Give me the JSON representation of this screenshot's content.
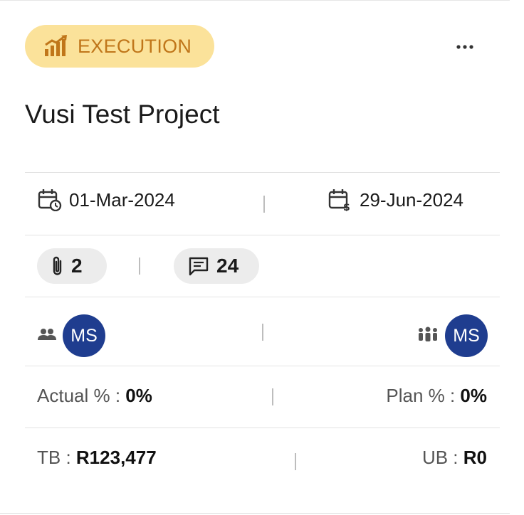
{
  "card": {
    "stage": {
      "label": "EXECUTION",
      "icon": "chart-growth-icon",
      "color": "#c0761a",
      "background": "#fbe29a"
    },
    "menu": {
      "icon": "more-horizontal-icon"
    },
    "title": "Vusi Test Project",
    "dates": {
      "start": {
        "value": "01-Mar-2024",
        "icon": "calendar-clock-icon"
      },
      "end": {
        "value": "29-Jun-2024",
        "icon": "calendar-dollar-icon"
      }
    },
    "counts": {
      "attachments": {
        "value": "2",
        "icon": "paperclip-icon"
      },
      "comments": {
        "value": "24",
        "icon": "comment-icon"
      }
    },
    "team": {
      "owners": {
        "icon": "users-icon",
        "avatar": "MS"
      },
      "members": {
        "icon": "group-icon",
        "avatar": "MS"
      },
      "avatar_color": "#1f3d8f"
    },
    "progress": {
      "actual_label": "Actual % :",
      "actual_value": "0%",
      "plan_label": "Plan % :",
      "plan_value": "0%"
    },
    "budget": {
      "tb_label": "TB :",
      "tb_value": "R123,477",
      "ub_label": "UB :",
      "ub_value": "R0"
    }
  }
}
